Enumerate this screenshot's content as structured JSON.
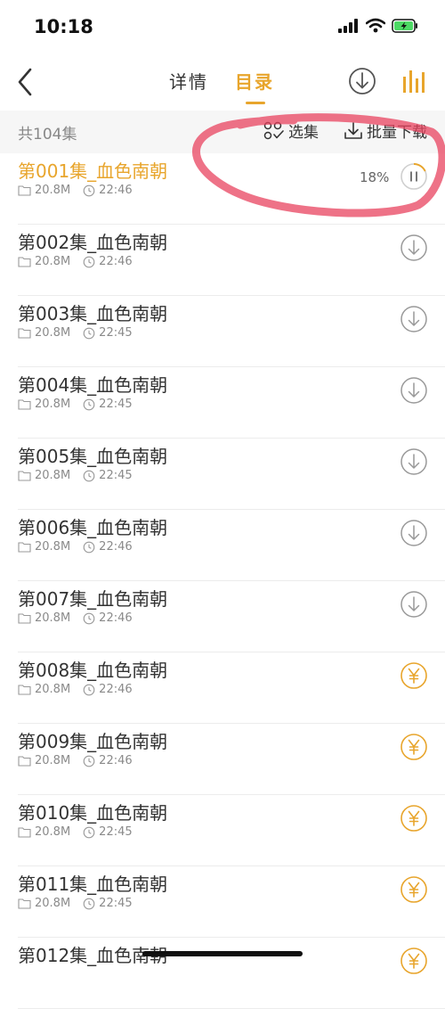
{
  "status": {
    "time": "10:18"
  },
  "nav": {
    "tabs": [
      {
        "label": "详情",
        "active": false
      },
      {
        "label": "目录",
        "active": true
      }
    ]
  },
  "toolbar": {
    "total": "共104集",
    "select_label": "选集",
    "batch_label": "批量下载"
  },
  "colors": {
    "accent": "#E8A52C",
    "annotation": "#E8435F"
  },
  "episodes": [
    {
      "title": "第001集_血色南朝",
      "size": "20.8M",
      "duration": "22:46",
      "state": "downloading",
      "progress": "18%",
      "progress_value": 0.18
    },
    {
      "title": "第002集_血色南朝",
      "size": "20.8M",
      "duration": "22:46",
      "state": "download"
    },
    {
      "title": "第003集_血色南朝",
      "size": "20.8M",
      "duration": "22:45",
      "state": "download"
    },
    {
      "title": "第004集_血色南朝",
      "size": "20.8M",
      "duration": "22:45",
      "state": "download"
    },
    {
      "title": "第005集_血色南朝",
      "size": "20.8M",
      "duration": "22:45",
      "state": "download"
    },
    {
      "title": "第006集_血色南朝",
      "size": "20.8M",
      "duration": "22:46",
      "state": "download"
    },
    {
      "title": "第007集_血色南朝",
      "size": "20.8M",
      "duration": "22:46",
      "state": "download"
    },
    {
      "title": "第008集_血色南朝",
      "size": "20.8M",
      "duration": "22:46",
      "state": "paid"
    },
    {
      "title": "第009集_血色南朝",
      "size": "20.8M",
      "duration": "22:46",
      "state": "paid"
    },
    {
      "title": "第010集_血色南朝",
      "size": "20.8M",
      "duration": "22:45",
      "state": "paid"
    },
    {
      "title": "第011集_血色南朝",
      "size": "20.8M",
      "duration": "22:45",
      "state": "paid"
    },
    {
      "title": "第012集_血色南朝",
      "size": "",
      "duration": "",
      "state": "paid"
    }
  ]
}
